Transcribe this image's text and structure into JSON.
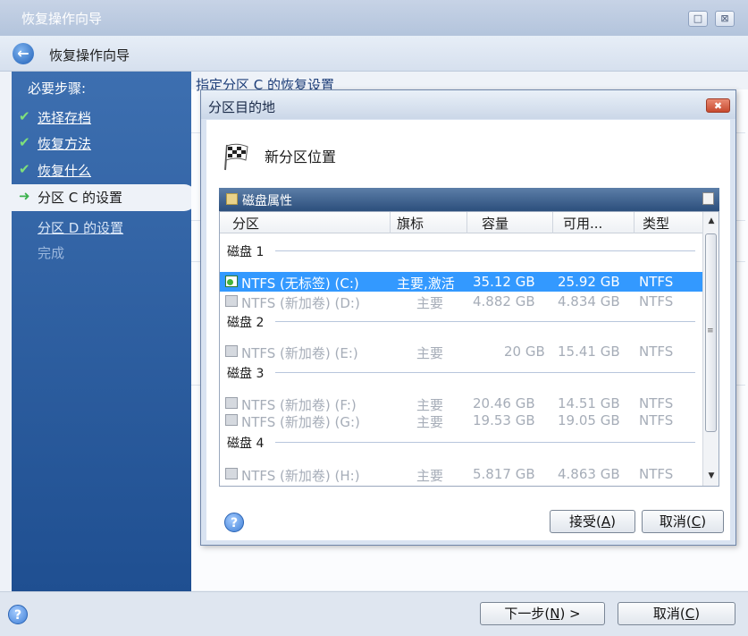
{
  "window": {
    "title": "恢复操作向导",
    "nav_title": "恢复操作向导",
    "controls": [
      "□",
      "⊠"
    ]
  },
  "sidebar": {
    "steps_label": "必要步骤:",
    "completed_steps": [
      {
        "check": "✔",
        "label": "选择存档"
      },
      {
        "check": "✔",
        "label": "恢复方法"
      },
      {
        "check": "✔",
        "label": "恢复什么"
      }
    ],
    "current_step": {
      "arrow": "➜",
      "label": "分区 C 的设置"
    },
    "next_step": "分区 D 的设置",
    "finish": "完成"
  },
  "main": {
    "header": "指定分区 C 的恢复设置"
  },
  "dialog": {
    "title": "分区目的地",
    "close_glyph": "✖",
    "location_title": "新分区位置",
    "panel_title": "磁盘属性",
    "columns": [
      "分区",
      "旗标",
      "容量",
      "可用...",
      "类型"
    ],
    "disks": [
      {
        "label": "磁盘 1",
        "partitions": [
          {
            "name": "NTFS (无标签) (C:)",
            "flags": "主要,激活",
            "capacity": "35.12 GB",
            "free": "25.92 GB",
            "type": "NTFS",
            "selected": true
          },
          {
            "name": "NTFS (新加卷) (D:)",
            "flags": "主要",
            "capacity": "4.882 GB",
            "free": "4.834 GB",
            "type": "NTFS",
            "selected": false
          }
        ]
      },
      {
        "label": "磁盘 2",
        "partitions": [
          {
            "name": "NTFS (新加卷) (E:)",
            "flags": "主要",
            "capacity": "20 GB",
            "free": "15.41 GB",
            "type": "NTFS",
            "selected": false
          }
        ]
      },
      {
        "label": "磁盘 3",
        "partitions": [
          {
            "name": "NTFS (新加卷) (F:)",
            "flags": "主要",
            "capacity": "20.46 GB",
            "free": "14.51 GB",
            "type": "NTFS",
            "selected": false
          },
          {
            "name": "NTFS (新加卷) (G:)",
            "flags": "主要",
            "capacity": "19.53 GB",
            "free": "19.05 GB",
            "type": "NTFS",
            "selected": false
          }
        ]
      },
      {
        "label": "磁盘 4",
        "partitions": [
          {
            "name": "NTFS (新加卷) (H:)",
            "flags": "主要",
            "capacity": "5.817 GB",
            "free": "4.863 GB",
            "type": "NTFS",
            "selected": false
          }
        ]
      }
    ],
    "accept_label": "接受(",
    "accept_key": "A",
    "cancel_label": "取消(",
    "cancel_key": "C",
    "help_glyph": "?"
  },
  "bottom": {
    "next_label": "下一步(",
    "next_key": "N",
    "next_suffix": ") >",
    "cancel_label": "取消(",
    "cancel_key": "C",
    "help_glyph": "?"
  },
  "colors": {
    "sidebar": "#2a5a9c",
    "selection": "#3399ff",
    "check": "#7fe07a"
  }
}
